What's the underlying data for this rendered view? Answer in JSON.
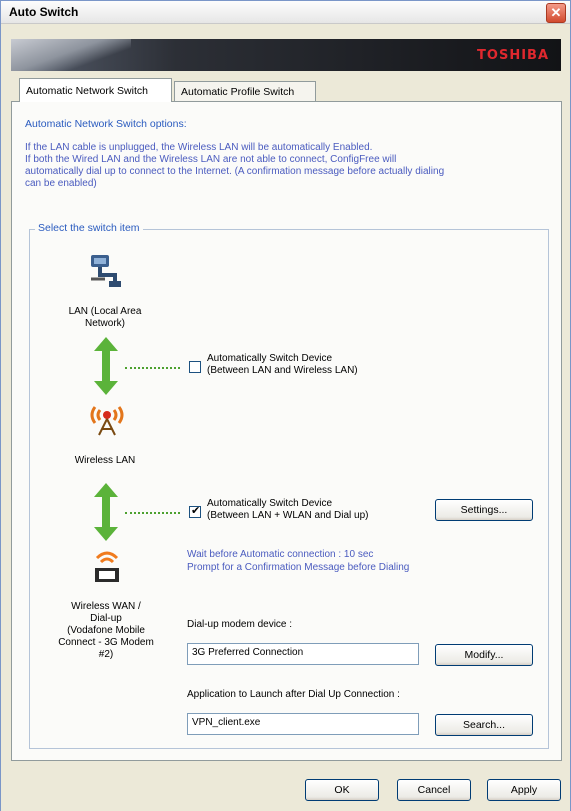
{
  "window": {
    "title": "Auto Switch",
    "brand": "TOSHIBA"
  },
  "tabs": [
    {
      "label": "Automatic Network Switch",
      "active": true
    },
    {
      "label": "Automatic Profile Switch",
      "active": false
    }
  ],
  "options": {
    "title": "Automatic Network Switch options:",
    "description": [
      "If the LAN cable is unplugged, the Wireless LAN will be automatically Enabled.",
      "If both the Wired LAN and the Wireless LAN are not able to connect, ConfigFree will",
      "automatically dial up to connect to the Internet. (A confirmation message before actually dialing",
      "can be enabled)"
    ]
  },
  "group": {
    "legend": "Select the switch item",
    "lan": {
      "label_line1": "LAN (Local Area",
      "label_line2": "Network)"
    },
    "switch1": {
      "checked": false,
      "line1": "Automatically Switch Device",
      "line2": "(Between LAN and Wireless LAN)"
    },
    "wlan": {
      "label": "Wireless LAN"
    },
    "switch2": {
      "checked": true,
      "line1": "Automatically Switch Device",
      "line2": "(Between LAN + WLAN and Dial up)"
    },
    "settings_button": "Settings...",
    "wait_info": "Wait before Automatic connection : 10 sec",
    "prompt_info": "Prompt for a Confirmation Message before Dialing",
    "wwan": {
      "line1": "Wireless WAN /",
      "line2": "Dial-up",
      "line3": "(Vodafone Mobile",
      "line4": "Connect - 3G Modem",
      "line5": "#2)"
    },
    "dialup_label": "Dial-up modem device :",
    "dialup_value": "3G Preferred Connection",
    "modify_button": "Modify...",
    "app_label": "Application to Launch after Dial Up Connection :",
    "app_value": "VPN_client.exe",
    "search_button": "Search..."
  },
  "buttons": {
    "ok": "OK",
    "cancel": "Cancel",
    "apply": "Apply"
  },
  "colors": {
    "accent_text": "#2a5bbf",
    "arrow_green": "#5bb33a",
    "brand_red": "#e0282e"
  }
}
